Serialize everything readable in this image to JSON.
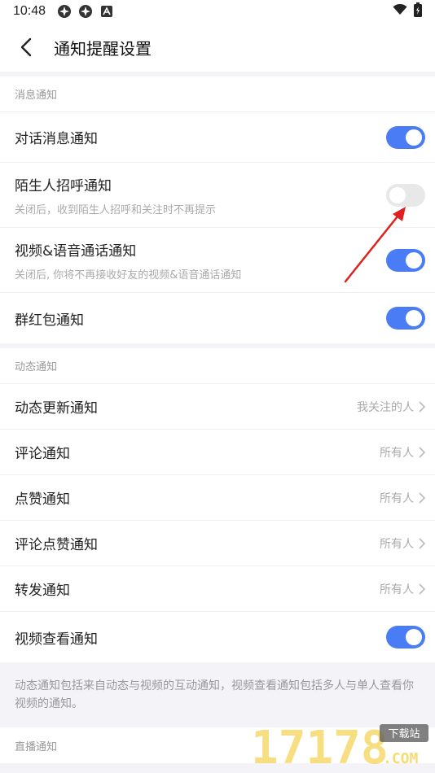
{
  "status": {
    "time": "10:48"
  },
  "header": {
    "title": "通知提醒设置"
  },
  "message_section": {
    "title": "消息通知",
    "items": [
      {
        "label": "对话消息通知",
        "sub": "",
        "state": "on"
      },
      {
        "label": "陌生人招呼通知",
        "sub": "关闭后，收到陌生人招呼和关注时不再提示",
        "state": "off"
      },
      {
        "label": "视频&语音通话通知",
        "sub": "关闭后, 你将不再接收好友的视频&语音通话通知",
        "state": "on"
      },
      {
        "label": "群红包通知",
        "sub": "",
        "state": "on"
      }
    ]
  },
  "dynamic_section": {
    "title": "动态通知",
    "items": [
      {
        "label": "动态更新通知",
        "value": "我关注的人"
      },
      {
        "label": "评论通知",
        "value": "所有人"
      },
      {
        "label": "点赞通知",
        "value": "所有人"
      },
      {
        "label": "评论点赞通知",
        "value": "所有人"
      },
      {
        "label": "转发通知",
        "value": "所有人"
      }
    ],
    "video_view": {
      "label": "视频查看通知",
      "state": "on"
    },
    "note": "动态通知包括来自动态与视频的互动通知，视频查看通知包括多人与单人查看你视频的通知。"
  },
  "live_section": {
    "title": "直播通知"
  },
  "watermark": {
    "site": "17178",
    "tag": "下载站",
    "domain": ".COM"
  },
  "colors": {
    "accent": "#4a7cf5",
    "toggle_off": "#e8e8e8",
    "annotation": "#e0201e"
  }
}
